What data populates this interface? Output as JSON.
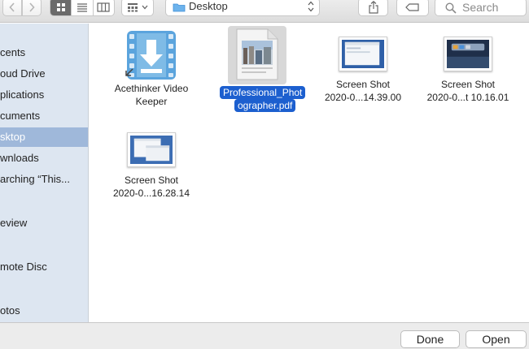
{
  "toolbar": {
    "location_label": "Desktop",
    "search_placeholder": "Search"
  },
  "sidebar": {
    "items": [
      {
        "label": "cents"
      },
      {
        "label": "oud Drive"
      },
      {
        "label": "plications"
      },
      {
        "label": "cuments"
      },
      {
        "label": "sktop"
      },
      {
        "label": "wnloads"
      },
      {
        "label": "arching “This..."
      },
      {
        "label": "eview"
      },
      {
        "label": "mote Disc"
      },
      {
        "label": "otos"
      }
    ]
  },
  "files": [
    {
      "line1": "Acethinker Video",
      "line2": "Keeper"
    },
    {
      "line1": "Professional_Phot",
      "line2": "ographer.pdf"
    },
    {
      "line1": "Screen Shot",
      "line2": "2020-0...14.39.00"
    },
    {
      "line1": "Screen Shot",
      "line2": "2020-0...t 10.16.01"
    },
    {
      "line1": "Screen Shot",
      "line2": "2020-0...16.28.14"
    }
  ],
  "buttons": {
    "done": "Done",
    "open": "Open"
  },
  "colors": {
    "sidebar_bg": "#dde6f1",
    "sidebar_selected": "#9fb8da",
    "selection_blue": "#1c5fcf",
    "app_icon_blue": "#5ba4dd"
  }
}
